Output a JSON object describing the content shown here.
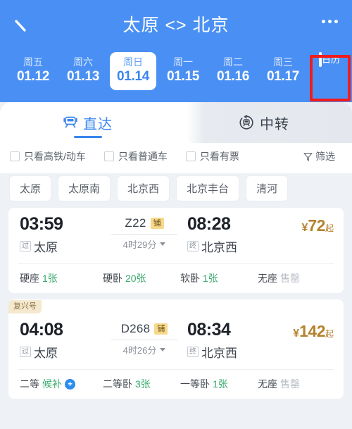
{
  "header": {
    "title": "太原 <> 北京",
    "back_icon": "back-arrow-icon",
    "more_icon": "more-options-icon",
    "accent_color": "#4a90f4"
  },
  "dates": [
    {
      "dow": "周五",
      "date": "01.12",
      "selected": false
    },
    {
      "dow": "周六",
      "date": "01.13",
      "selected": false
    },
    {
      "dow": "周日",
      "date": "01.14",
      "selected": true
    },
    {
      "dow": "周一",
      "date": "01.15",
      "selected": false
    },
    {
      "dow": "周二",
      "date": "01.16",
      "selected": false
    },
    {
      "dow": "周三",
      "date": "01.17",
      "selected": false
    }
  ],
  "calendar_button": {
    "label": "日历",
    "icon": "calendar-icon",
    "highlight_color": "#f21b1b"
  },
  "tabs": [
    {
      "label": "直达",
      "icon": "train-icon",
      "active": true
    },
    {
      "label": "中转",
      "icon": "transfer-icon",
      "active": false
    }
  ],
  "filters": {
    "checkboxes": [
      {
        "label": "只看高铁/动车",
        "checked": false
      },
      {
        "label": "只看普通车",
        "checked": false
      },
      {
        "label": "只看有票",
        "checked": false
      }
    ],
    "sort": {
      "label": "筛选",
      "icon": "funnel-icon"
    }
  },
  "stations": [
    "太原",
    "太原南",
    "北京西",
    "北京丰台",
    "清河"
  ],
  "trains": [
    {
      "tag": "",
      "depart_time": "03:59",
      "depart_tag": "过",
      "depart_station": "太原",
      "train_no": "Z22",
      "train_badge": "铺",
      "duration": "4时29分",
      "arrive_time": "08:28",
      "arrive_tag": "终",
      "arrive_station": "北京西",
      "price_currency": "¥",
      "price_amount": "72",
      "price_suffix": "起",
      "seats": [
        {
          "name": "硬座",
          "count": "1张",
          "status": "available"
        },
        {
          "name": "硬卧",
          "count": "20张",
          "status": "available"
        },
        {
          "name": "软卧",
          "count": "1张",
          "status": "available"
        },
        {
          "name": "无座",
          "count": "售罄",
          "status": "soldout"
        }
      ]
    },
    {
      "tag": "复兴号",
      "depart_time": "04:08",
      "depart_tag": "过",
      "depart_station": "太原",
      "train_no": "D268",
      "train_badge": "铺",
      "duration": "4时26分",
      "arrive_time": "08:34",
      "arrive_tag": "终",
      "arrive_station": "北京西",
      "price_currency": "¥",
      "price_amount": "142",
      "price_suffix": "起",
      "seats": [
        {
          "name": "二等",
          "count": "候补",
          "status": "pending",
          "plus": "+"
        },
        {
          "name": "二等卧",
          "count": "3张",
          "status": "available"
        },
        {
          "name": "一等卧",
          "count": "1张",
          "status": "available"
        },
        {
          "name": "无座",
          "count": "售罄",
          "status": "soldout"
        }
      ]
    }
  ]
}
